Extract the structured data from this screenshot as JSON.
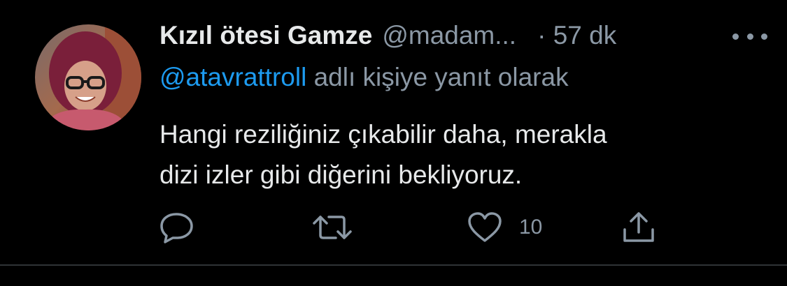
{
  "tweet": {
    "author_name": "Kızıl ötesi Gamze",
    "author_handle": "@madam...",
    "time": "· 57 dk",
    "reply_mention": "@atavrattroll",
    "reply_suffix": " adlı kişiye yanıt olarak",
    "text_line1": "Hangi reziliğiniz çıkabilir daha, merakla",
    "text_line2": "dizi izler gibi diğerini bekliyoruz.",
    "like_count": "10"
  },
  "icons": {
    "reply": "reply-icon",
    "retweet": "retweet-icon",
    "like": "heart-icon",
    "share": "share-icon",
    "more": "more-icon"
  },
  "colors": {
    "background": "#000000",
    "text": "#e7e9ea",
    "secondary": "#8b98a5",
    "link": "#1d9bf0",
    "divider": "#2f3336"
  }
}
